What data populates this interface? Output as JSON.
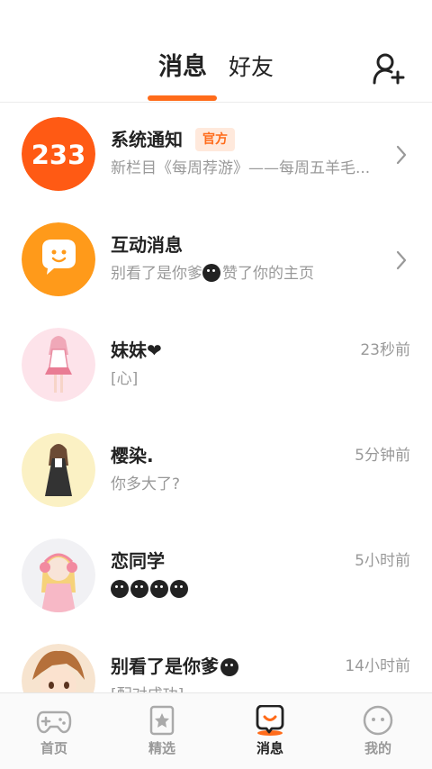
{
  "header": {
    "tabs": [
      {
        "label": "消息",
        "active": true
      },
      {
        "label": "好友",
        "active": false
      }
    ],
    "add_friend_icon": "add-user-icon"
  },
  "conversations": [
    {
      "name": "系统通知",
      "badge": "官方",
      "preview": "新栏目《每周荐游》——每周五羊毛...",
      "time": "",
      "has_chevron": true,
      "avatar": "233-logo"
    },
    {
      "name": "互动消息",
      "preview_parts": [
        "别看了是你爹",
        "赞了你的主页"
      ],
      "time": "",
      "has_chevron": true,
      "avatar": "chat-bubble-icon"
    },
    {
      "name": "妹妹❤",
      "preview": "[心]",
      "time": "23秒前",
      "avatar": "anime-girl-pink"
    },
    {
      "name": "樱染.",
      "preview": "你多大了?",
      "time": "5分钟前",
      "avatar": "anime-girl-dark-dress"
    },
    {
      "name": "恋同学",
      "preview": "",
      "time": "5小时前",
      "avatar": "anime-girl-headphones"
    },
    {
      "name": "别看了是你爹",
      "preview": "[配对成功]",
      "time": "14小时前",
      "avatar": "anime-boy-brown-hair"
    }
  ],
  "bottom_nav": [
    {
      "label": "首页",
      "icon": "gamepad-icon",
      "active": false
    },
    {
      "label": "精选",
      "icon": "star-card-icon",
      "active": false
    },
    {
      "label": "消息",
      "icon": "message-smile-icon",
      "active": true
    },
    {
      "label": "我的",
      "icon": "face-icon",
      "active": false
    }
  ],
  "colors": {
    "accent": "#ff6b1a",
    "badge_bg": "#ffe9dc",
    "text_secondary": "#999999"
  }
}
